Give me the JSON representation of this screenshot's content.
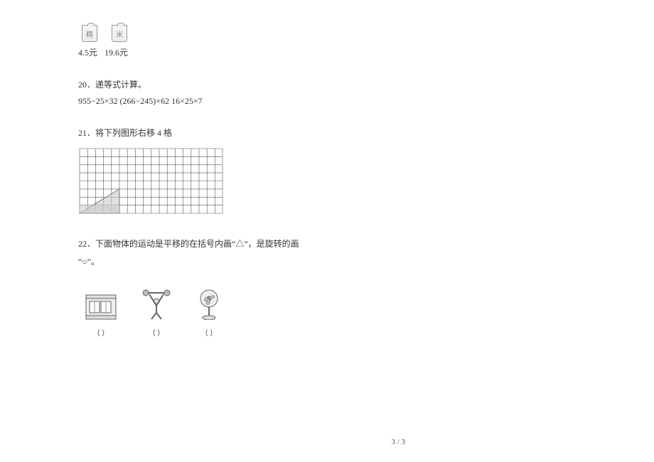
{
  "top": {
    "bags": [
      {
        "label": "精",
        "price": "4.5元"
      },
      {
        "label": "米",
        "price": "19.6元"
      }
    ]
  },
  "q20": {
    "num": "20．",
    "title": "递等式计算。",
    "exprs": "955−25×32  (266−245)×62       16×25×7"
  },
  "q21": {
    "num": "21．",
    "title": "将下列图形右移 4 格"
  },
  "q22": {
    "num": "22．",
    "title_line1": "下面物体的运动是平移的在括号内画“△”，是旋转的画",
    "title_line2": "“○”。",
    "items": [
      {
        "paren": "（  ）"
      },
      {
        "paren": "（  ）"
      },
      {
        "paren": "（  ）"
      }
    ]
  },
  "pagenum": "3 / 3"
}
